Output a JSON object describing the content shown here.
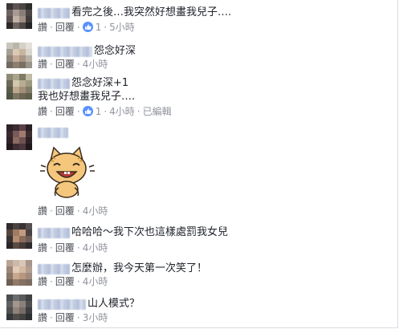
{
  "colors": {
    "link": "#365899",
    "meta": "#90949c",
    "text": "#1d2129",
    "like_badge": "#5890ff"
  },
  "comments": [
    {
      "text": "看完之後…我突然好想畫我兒子….",
      "actions": {
        "reply_label": "讚",
        "respond_label": "回覆",
        "likes": "1",
        "time": "5小時"
      }
    },
    {
      "text": "怨念好深",
      "actions": {
        "reply_label": "讚",
        "respond_label": "回覆",
        "time": "4小時"
      }
    },
    {
      "text": "怨念好深+1",
      "text2": "我也好想畫我兒子….",
      "actions": {
        "reply_label": "讚",
        "respond_label": "回覆",
        "likes": "1",
        "time": "4小時",
        "edited": "已編輯"
      }
    },
    {
      "sticker_icon": "laughing-cat-sticker-icon",
      "actions": {
        "reply_label": "讚",
        "respond_label": "回覆",
        "time": "4小時"
      }
    },
    {
      "text": "哈哈哈～我下次也這樣處罰我女兒",
      "actions": {
        "reply_label": "讚",
        "respond_label": "回覆",
        "time": "4小時"
      }
    },
    {
      "text": "怎麼辦，我今天第一次笑了！",
      "actions": {
        "reply_label": "讚",
        "respond_label": "回覆",
        "time": "4小時"
      }
    },
    {
      "text": "山人模式？",
      "actions": {
        "reply_label": "讚",
        "respond_label": "回覆",
        "time": "3小時"
      }
    }
  ]
}
